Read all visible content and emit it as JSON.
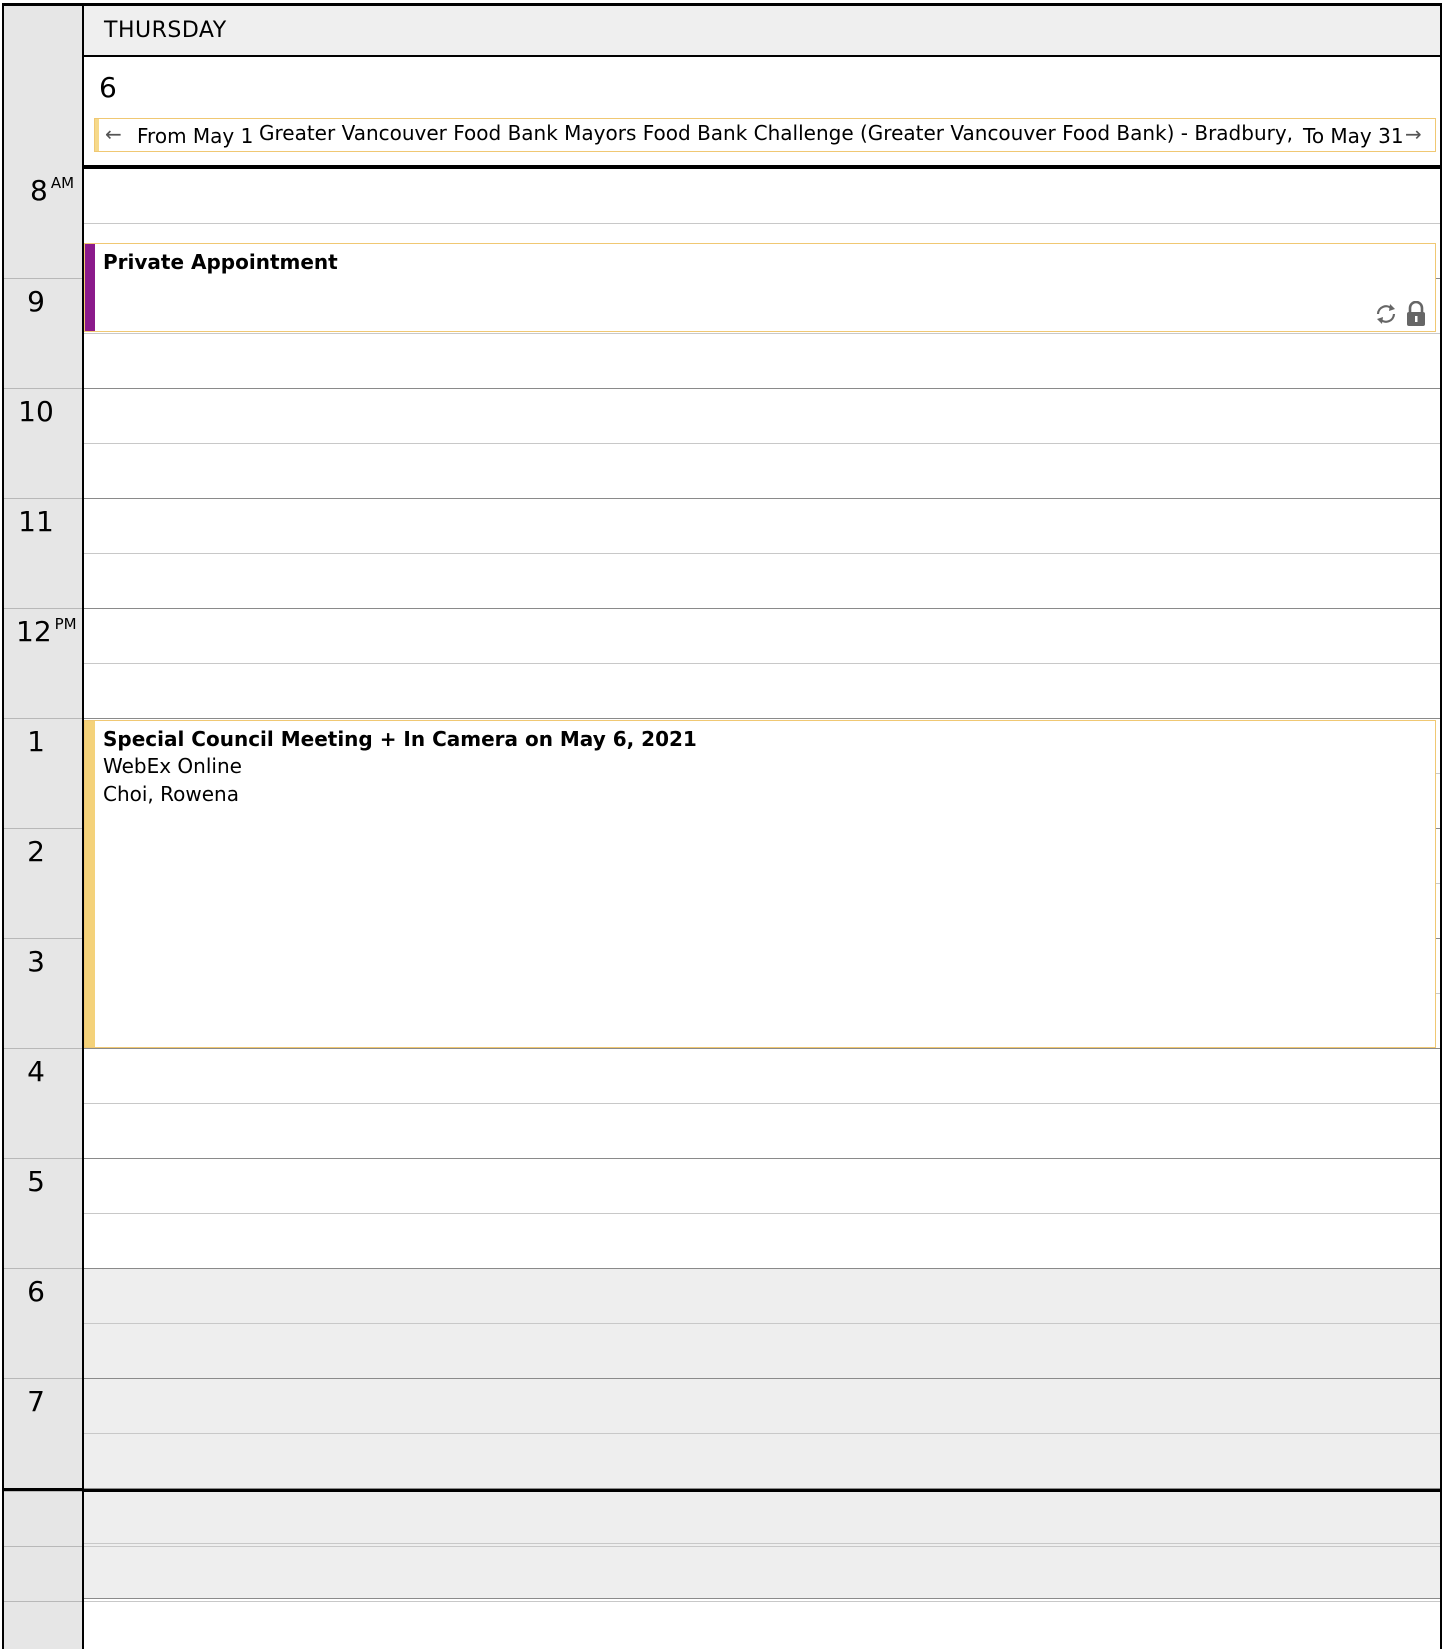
{
  "day": {
    "name": "THURSDAY",
    "number": "6"
  },
  "all_day_event": {
    "from": "From May 1",
    "title": "Greater Vancouver Food Bank Mayors Food Bank Challenge (Greater Vancouver Food Bank) - Bradbury, Wanda",
    "to": "To May 31"
  },
  "hours": [
    {
      "label": "8",
      "suffix": "AM"
    },
    {
      "label": "9",
      "suffix": ""
    },
    {
      "label": "10",
      "suffix": ""
    },
    {
      "label": "11",
      "suffix": ""
    },
    {
      "label": "12",
      "suffix": "PM"
    },
    {
      "label": "1",
      "suffix": ""
    },
    {
      "label": "2",
      "suffix": ""
    },
    {
      "label": "3",
      "suffix": ""
    },
    {
      "label": "4",
      "suffix": ""
    },
    {
      "label": "5",
      "suffix": ""
    },
    {
      "label": "6",
      "suffix": ""
    },
    {
      "label": "7",
      "suffix": ""
    }
  ],
  "appointments": [
    {
      "subject": "Private Appointment",
      "bar_color": "#8b1a8b",
      "icons": [
        "recurring-icon",
        "lock-icon"
      ]
    },
    {
      "subject": "Special Council Meeting + In Camera on May 6, 2021",
      "location": "WebEx Online",
      "organizer": "Choi, Rowena",
      "bar_color": "#f4d27a"
    }
  ],
  "colors": {
    "accent_border": "#f0c873",
    "off_hours": "#eeeeee",
    "time_column": "#e6e6e6"
  }
}
